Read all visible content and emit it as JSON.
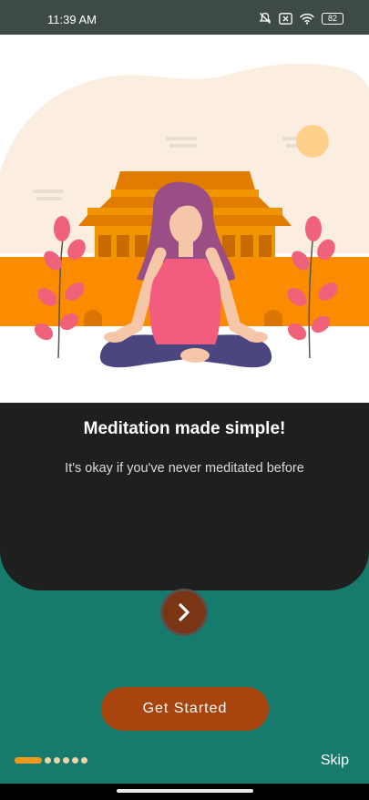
{
  "status_bar": {
    "time": "11:39 AM",
    "battery": "82",
    "icons": [
      "bell-muted-icon",
      "sim-x-icon",
      "wifi-icon",
      "battery-icon"
    ]
  },
  "hero": {
    "illustration": "woman-meditating-temple-illustration",
    "colors": {
      "accent_orange": "#fb8c00",
      "sun": "#ffd08a",
      "plant_pink": "#f0617a"
    }
  },
  "content": {
    "title": "Meditation made simple!",
    "subtitle": "It's okay if you've never meditated before"
  },
  "next_button": {
    "icon": "chevron-right-icon"
  },
  "get_started_button": {
    "label": "Get Started"
  },
  "pager": {
    "total": 6,
    "active_index": 0
  },
  "skip": {
    "label": "Skip"
  },
  "colors": {
    "background": "#167a6c",
    "card": "#1f1f1f",
    "button": "#a8440d",
    "indicator_active": "#f39a1d",
    "indicator_inactive": "#f2d3a8"
  }
}
